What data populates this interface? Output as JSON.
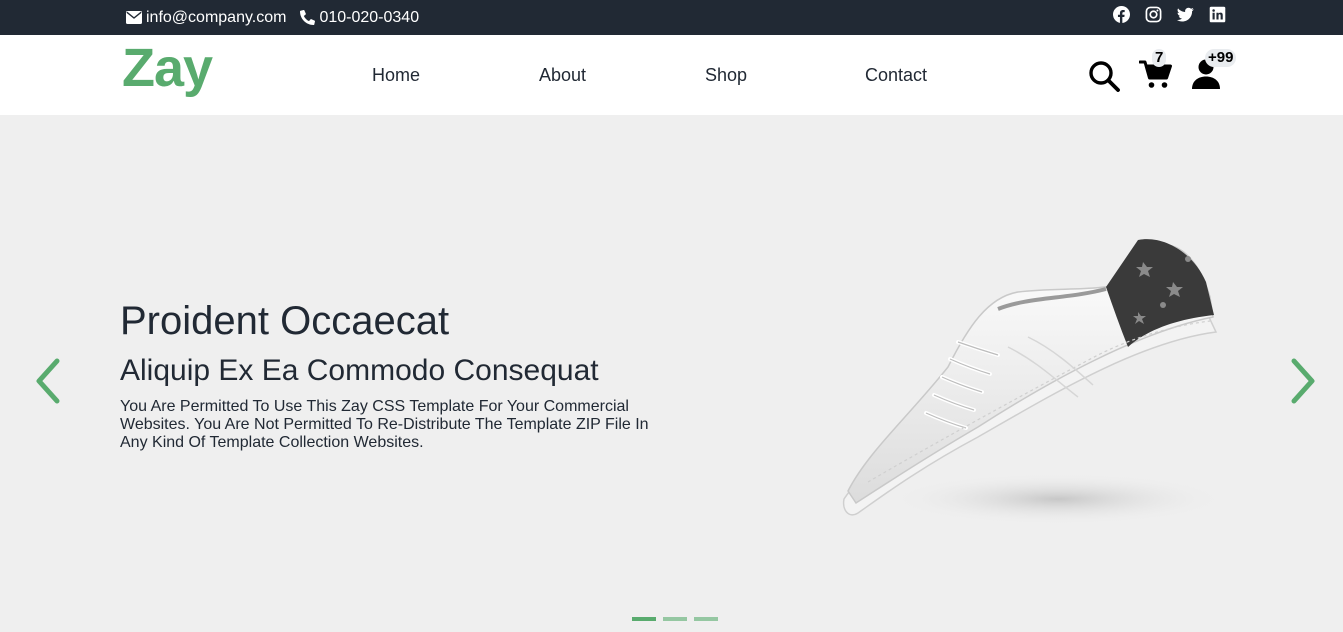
{
  "topbar": {
    "email": "info@company.com",
    "phone": "010-020-0340",
    "social": [
      "facebook-icon",
      "instagram-icon",
      "twitter-icon",
      "linkedin-icon"
    ]
  },
  "navbar": {
    "logo": "Zay",
    "links": [
      "Home",
      "About",
      "Shop",
      "Contact"
    ],
    "cart_count": "7",
    "user_count": "+99"
  },
  "hero": {
    "title": "Proident Occaecat",
    "subtitle": "Aliquip Ex Ea Commodo Consequat",
    "text": "You Are Permitted To Use This Zay CSS Template For Your Commercial Websites. You Are Not Permitted To Re-Distribute The Template ZIP File In Any Kind Of Template Collection Websites.",
    "slides": 3,
    "active_slide": 1
  },
  "colors": {
    "brand": "#59ab6e",
    "dark": "#212934",
    "hero_bg": "#efefef"
  }
}
